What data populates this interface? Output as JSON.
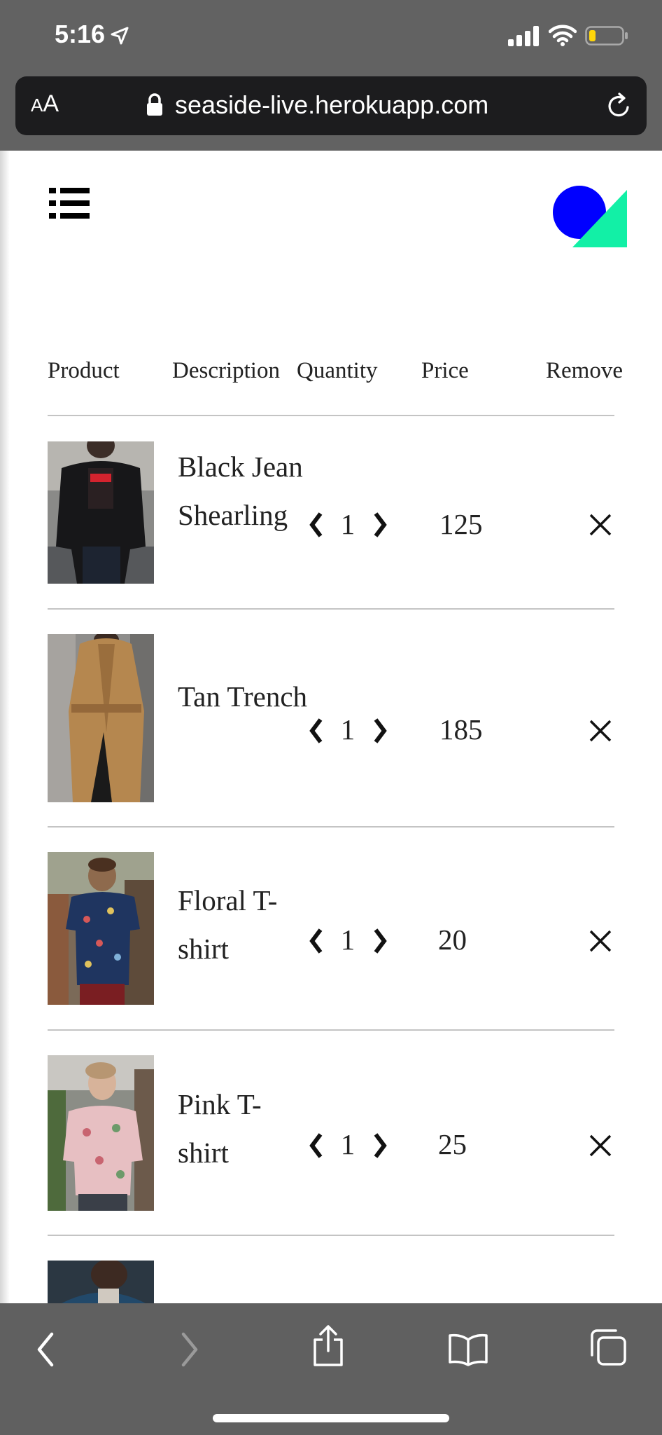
{
  "status_bar": {
    "time": "5:16"
  },
  "browser": {
    "text_size_label_small": "A",
    "text_size_label_large": "A",
    "url": "seaside-live.herokuapp.com"
  },
  "cart": {
    "headers": {
      "product": "Product",
      "description": "Description",
      "quantity": "Quantity",
      "price": "Price",
      "remove": "Remove"
    },
    "items": [
      {
        "description": "Black Jean Shearling",
        "quantity": "1",
        "price": "125"
      },
      {
        "description": "Tan Trench",
        "quantity": "1",
        "price": "185"
      },
      {
        "description": "Floral T-shirt",
        "quantity": "1",
        "price": "20"
      },
      {
        "description": "Pink T-shirt",
        "quantity": "1",
        "price": "25"
      }
    ]
  },
  "icons": {
    "menu": "list-menu-icon",
    "logo": "circle-triangle-logo",
    "decrement": "chevron-left-icon",
    "increment": "chevron-right-icon",
    "remove": "close-icon",
    "back": "chevron-left-icon",
    "forward": "chevron-right-icon",
    "share": "share-icon",
    "bookmarks": "book-icon",
    "tabs": "tabs-icon"
  },
  "colors": {
    "logo_circle": "#0000ff",
    "logo_triangle": "#12f0a6",
    "browser_chrome": "#606060",
    "url_field": "#1c1c1e",
    "battery_low": "#ffd60a"
  }
}
